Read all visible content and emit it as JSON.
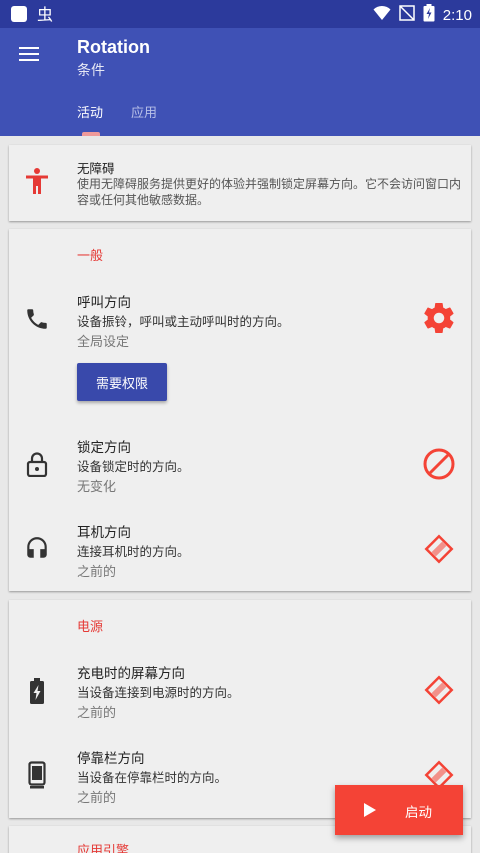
{
  "status_bar": {
    "time": "2:10"
  },
  "app_bar": {
    "title": "Rotation",
    "subtitle": "条件",
    "tabs": [
      {
        "label": "活动",
        "active": true
      },
      {
        "label": "应用",
        "active": false
      }
    ]
  },
  "accessibility": {
    "title": "无障碍",
    "description": "使用无障碍服务提供更好的体验并强制锁定屏幕方向。它不会访问窗口内容或任何其他敏感数据。",
    "icon": "accessibility-icon"
  },
  "general": {
    "header": "一般",
    "call": {
      "title": "呼叫方向",
      "description": "设备振铃，呼叫或主动呼叫时的方向。",
      "value": "全局设定",
      "button_label": "需要权限",
      "icon": "phone-icon",
      "action_icon": "gear-icon"
    },
    "lock": {
      "title": "锁定方向",
      "description": "设备锁定时的方向。",
      "value": "无变化",
      "icon": "lock-icon",
      "action_icon": "no-change-icon"
    },
    "headset": {
      "title": "耳机方向",
      "description": "连接耳机时的方向。",
      "value": "之前的",
      "icon": "headphones-icon",
      "action_icon": "previous-orientation-icon"
    }
  },
  "power": {
    "header": "电源",
    "charging": {
      "title": "充电时的屏幕方向",
      "description": "当设备连接到电源时的方向。",
      "value": "之前的",
      "icon": "battery-charging-icon",
      "action_icon": "previous-orientation-icon"
    },
    "dock": {
      "title": "停靠栏方向",
      "description": "当设备在停靠栏时的方向。",
      "value": "之前的",
      "icon": "dock-icon",
      "action_icon": "previous-orientation-icon"
    }
  },
  "engine": {
    "header": "应用引擎"
  },
  "fab": {
    "label": "启动"
  },
  "colors": {
    "primary": "#3f51b5",
    "primary_dark": "#2c3a9c",
    "accent": "#f44336",
    "button": "#3949ab"
  }
}
